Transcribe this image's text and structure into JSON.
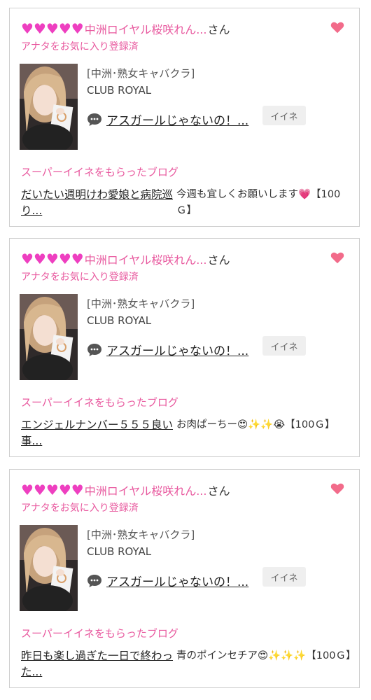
{
  "cards": [
    {
      "hearts": 5,
      "name": "中洲ロイヤル桜咲れん...",
      "suffix": "さん",
      "registered": "アナタをお気に入り登録済",
      "area": "[中洲･熟女キャバクラ]",
      "shop": "CLUB ROYAL",
      "comment": "アスガールじゃないの！...",
      "iine_label": "イイネ",
      "super_label": "スーパーイイネをもらったブログ",
      "blog_title": "だいたい週明けわ愛娘と病院巡り...",
      "blog_desc": "今週も宜しくお願いします💗【100Ｇ】"
    },
    {
      "hearts": 5,
      "name": "中洲ロイヤル桜咲れん...",
      "suffix": "さん",
      "registered": "アナタをお気に入り登録済",
      "area": "[中洲･熟女キャバクラ]",
      "shop": "CLUB ROYAL",
      "comment": "アスガールじゃないの！...",
      "iine_label": "イイネ",
      "super_label": "スーパーイイネをもらったブログ",
      "blog_title": "エンジェルナンバー５５５良い事...",
      "blog_desc": "お肉ぱーちー😍✨✨😭【100Ｇ】"
    },
    {
      "hearts": 5,
      "name": "中洲ロイヤル桜咲れん...",
      "suffix": "さん",
      "registered": "アナタをお気に入り登録済",
      "area": "[中洲･熟女キャバクラ]",
      "shop": "CLUB ROYAL",
      "comment": "アスガールじゃないの！...",
      "iine_label": "イイネ",
      "super_label": "スーパーイイネをもらったブログ",
      "blog_title": "昨日も楽し過ぎた一日で終わった...",
      "blog_desc": "青のポインセチア😍✨✨✨【100Ｇ】"
    }
  ],
  "colors": {
    "accent": "#e8589e",
    "heart": "#ee3fc0",
    "fav": "#f26b8a"
  },
  "icons": {
    "heart": "pink-heart-icon",
    "fav": "favorite-heart-icon",
    "comment": "speech-bubble-icon"
  }
}
